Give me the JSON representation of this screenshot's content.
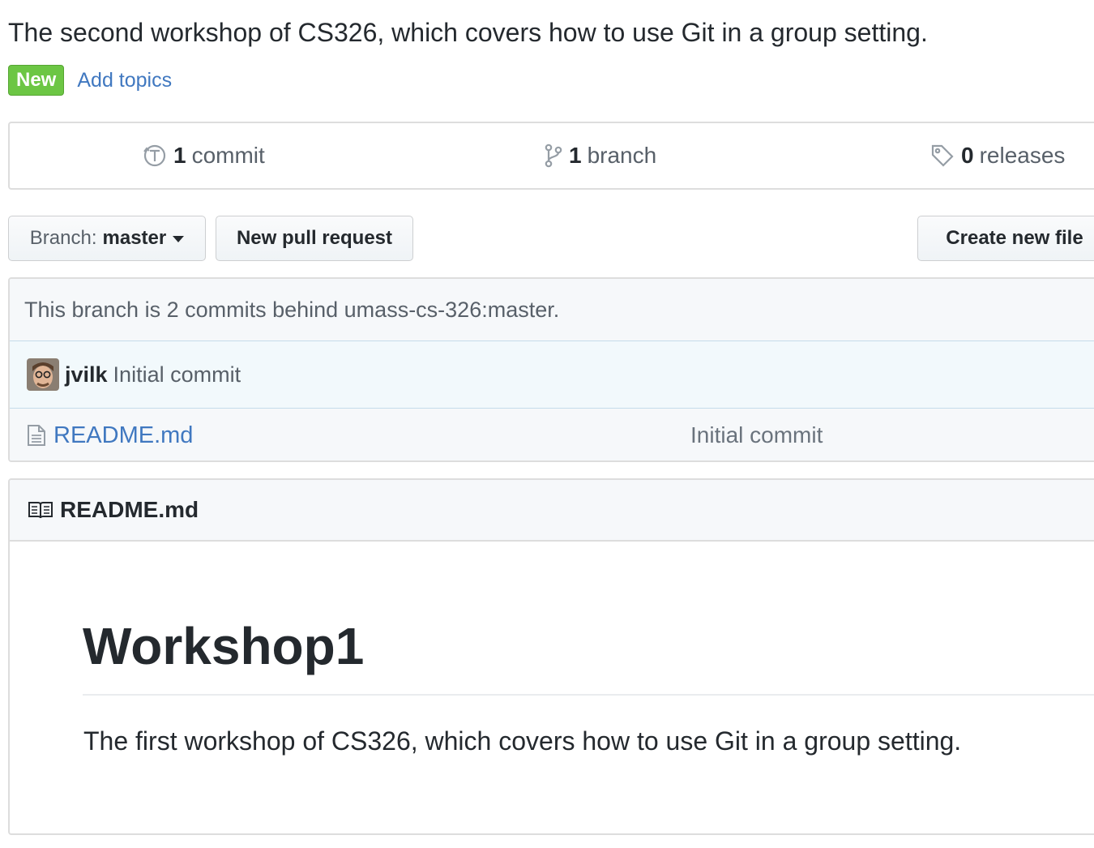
{
  "repo": {
    "description": "The second workshop of CS326, which covers how to use Git in a group setting.",
    "new_badge": "New",
    "add_topics": "Add topics"
  },
  "summary": {
    "commits_count": "1",
    "commits_label": "commit",
    "branches_count": "1",
    "branches_label": "branch",
    "releases_count": "0",
    "releases_label": "releases"
  },
  "toolbar": {
    "branch_prefix": "Branch:",
    "branch_name": "master",
    "new_pull_request": "New pull request",
    "create_new_file": "Create new file"
  },
  "file_list": {
    "branch_status": "This branch is 2 commits behind umass-cs-326:master.",
    "latest_commit": {
      "author": "jvilk",
      "message": "Initial commit"
    },
    "files": [
      {
        "icon": "file-text-icon",
        "name": "README.md",
        "commit_message": "Initial commit"
      }
    ]
  },
  "readme": {
    "header": "README.md",
    "heading": "Workshop1",
    "paragraph": "The first workshop of CS326, which covers how to use Git in a group setting."
  },
  "colors": {
    "link": "#4078c0",
    "new_badge": "#6cc644",
    "text": "#24292e",
    "muted": "#586069",
    "border": "#dddddd"
  }
}
